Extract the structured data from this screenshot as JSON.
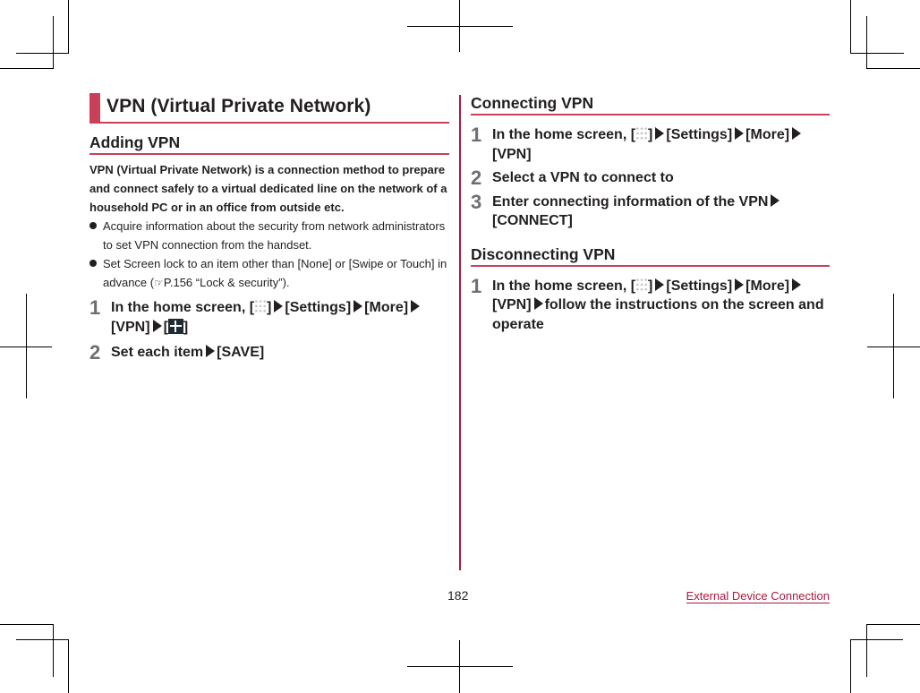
{
  "left": {
    "title": "VPN (Virtual Private Network)",
    "section_heading": "Adding VPN",
    "intro": "VPN (Virtual Private Network) is a connection method to prepare and connect safely to a virtual dedicated line on the network of a household PC or in an office from outside etc.",
    "bullets": [
      {
        "text": "Acquire information about the security from network administrators to set VPN connection from the handset."
      },
      {
        "text_before": "Set Screen lock to an item other than [None] or [Swipe or Touch] in advance (",
        "ref_icon": "☞",
        "text_after": "P.156 “Lock & security”)."
      }
    ],
    "steps": [
      {
        "num": "1",
        "p1": "In the home screen, [",
        "p2": "]",
        "p3": "[Settings]",
        "p4": "[More]",
        "p5": "[VPN]",
        "p6": "[",
        "p7": "]"
      },
      {
        "num": "2",
        "p1": "Set each item",
        "p2": "[SAVE]"
      }
    ]
  },
  "right": {
    "connecting": {
      "heading": "Connecting VPN",
      "steps": [
        {
          "num": "1",
          "p1": "In the home screen, [",
          "p2": "]",
          "p3": "[Settings]",
          "p4": "[More]",
          "p5": "[VPN]"
        },
        {
          "num": "2",
          "text": "Select a VPN to connect to"
        },
        {
          "num": "3",
          "p1": "Enter connecting information of the VPN",
          "p2": "[CONNECT]"
        }
      ]
    },
    "disconnecting": {
      "heading": "Disconnecting VPN",
      "steps": [
        {
          "num": "1",
          "p1": "In the home screen, [",
          "p2": "]",
          "p3": "[Settings]",
          "p4": "[More]",
          "p5": "[VPN]",
          "p6": "follow the instructions on the screen and operate"
        }
      ]
    }
  },
  "footer": {
    "page_number": "182",
    "chapter_link": "External Device Connection"
  },
  "colors": {
    "accent": "#c8405a",
    "link": "#b0173b",
    "step_number": "#6d6e71"
  }
}
